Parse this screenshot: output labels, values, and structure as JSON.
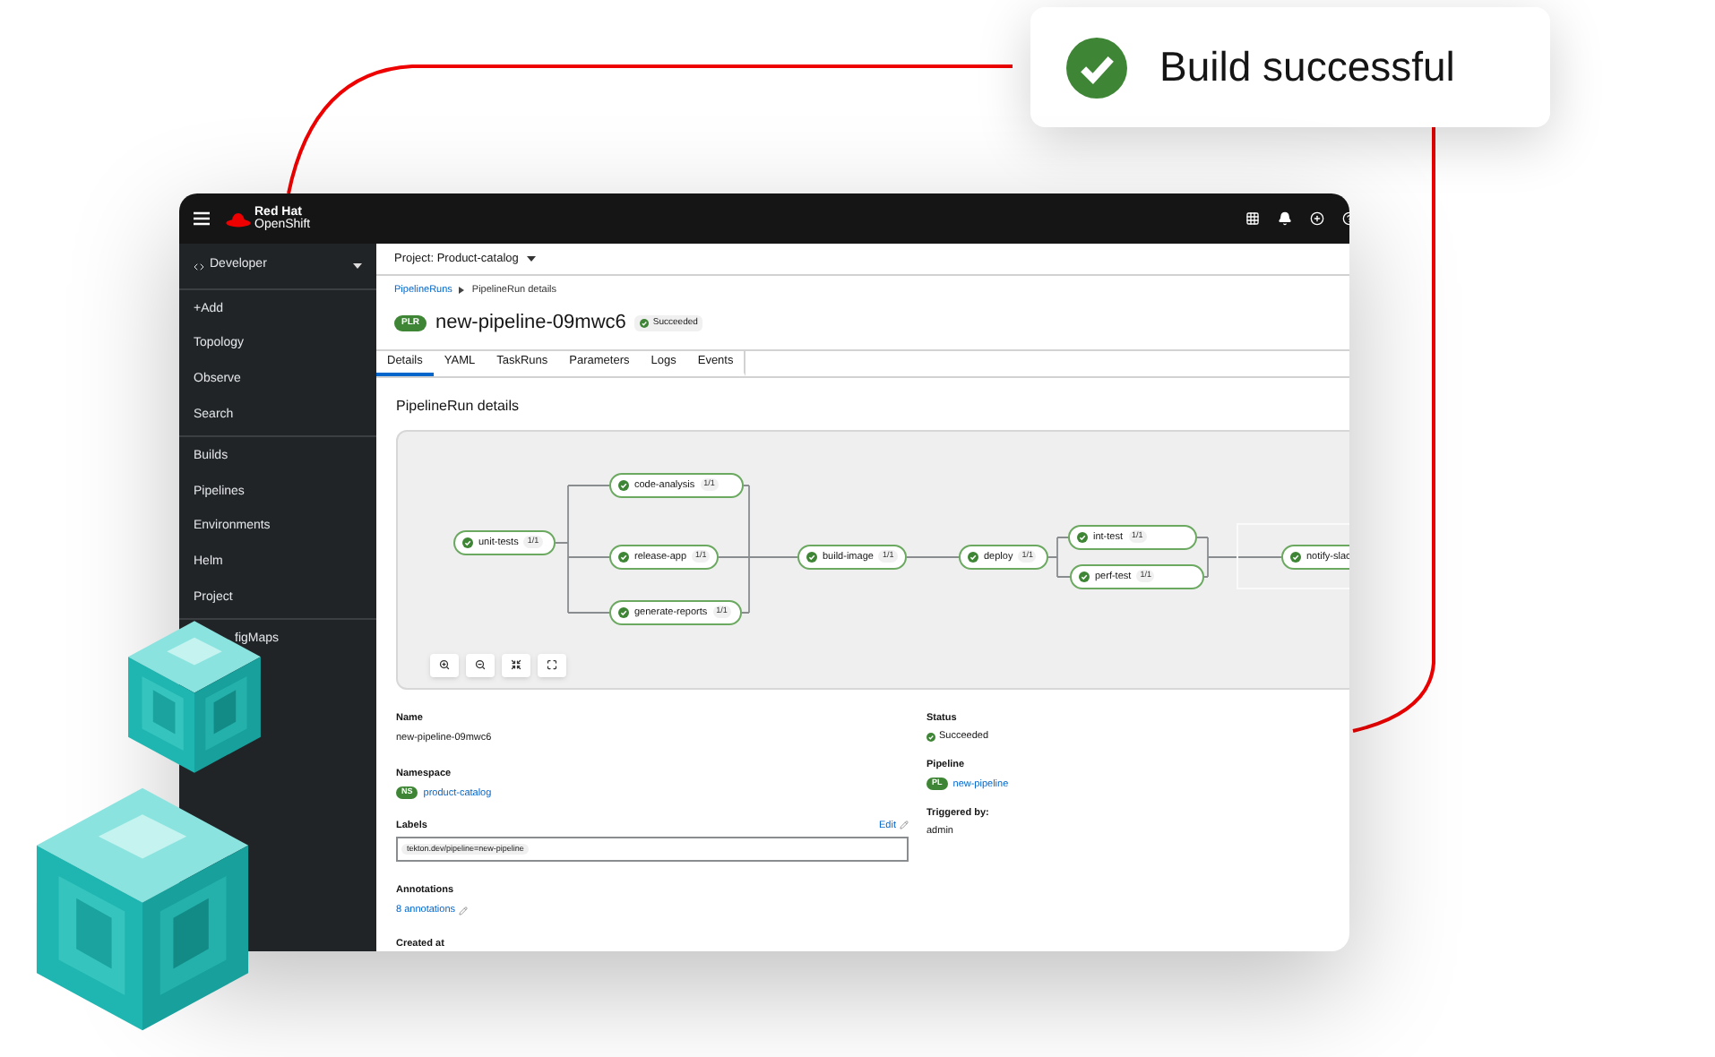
{
  "toast": {
    "message": "Build successful"
  },
  "masthead": {
    "brand_top": "Red Hat",
    "brand_bottom": "OpenShift"
  },
  "sidebar": {
    "perspective": "Developer",
    "sections": [
      {
        "items": [
          "+Add",
          "Topology",
          "Observe",
          "Search"
        ]
      },
      {
        "items": [
          "Builds",
          "Pipelines",
          "Environments",
          "Helm",
          "Project"
        ]
      },
      {
        "items": [
          "figMaps"
        ]
      }
    ]
  },
  "project_bar": {
    "label": "Project: Product-catalog"
  },
  "breadcrumb": [
    {
      "label": "PipelineRuns",
      "kind": "link"
    },
    {
      "label": "PipelineRun details",
      "kind": "current"
    }
  ],
  "title": {
    "badge": "PLR",
    "name": "new-pipeline-09mwc6",
    "status": "Succeeded"
  },
  "tabs": [
    {
      "label": "Details",
      "selected": true
    },
    {
      "label": "YAML",
      "selected": false
    },
    {
      "label": "TaskRuns",
      "selected": false
    },
    {
      "label": "Parameters",
      "selected": false
    },
    {
      "label": "Logs",
      "selected": false
    },
    {
      "label": "Events",
      "selected": false
    }
  ],
  "section_title": "PipelineRun details",
  "graph": {
    "nodes": [
      {
        "name": "unit-tests",
        "count": "1/1",
        "succeeded": true
      },
      {
        "name": "code-analysis",
        "count": "1/1",
        "succeeded": true
      },
      {
        "name": "release-app",
        "count": "1/1",
        "succeeded": true
      },
      {
        "name": "generate-reports",
        "count": "1/1",
        "succeeded": true
      },
      {
        "name": "build-image",
        "count": "1/1",
        "succeeded": true
      },
      {
        "name": "deploy",
        "count": "1/1",
        "succeeded": true
      },
      {
        "name": "int-test",
        "count": "1/1",
        "succeeded": true
      },
      {
        "name": "perf-test",
        "count": "1/1",
        "succeeded": true
      },
      {
        "name": "notify-slac",
        "succeeded": true
      }
    ]
  },
  "details": {
    "name": {
      "label": "Name",
      "value": "new-pipeline-09mwc6"
    },
    "namespace": {
      "label": "Namespace",
      "badge": "NS",
      "value": "product-catalog"
    },
    "labels": {
      "label": "Labels",
      "edit": "Edit",
      "chips": [
        "tekton.dev/pipeline=new-pipeline"
      ]
    },
    "annotations": {
      "label": "Annotations",
      "value": "8 annotations"
    },
    "created": {
      "label": "Created at"
    },
    "status": {
      "label": "Status",
      "value": "Succeeded"
    },
    "pipeline": {
      "label": "Pipeline",
      "badge": "PL",
      "value": "new-pipeline"
    },
    "triggered": {
      "label": "Triggered by:",
      "value": "admin"
    }
  }
}
